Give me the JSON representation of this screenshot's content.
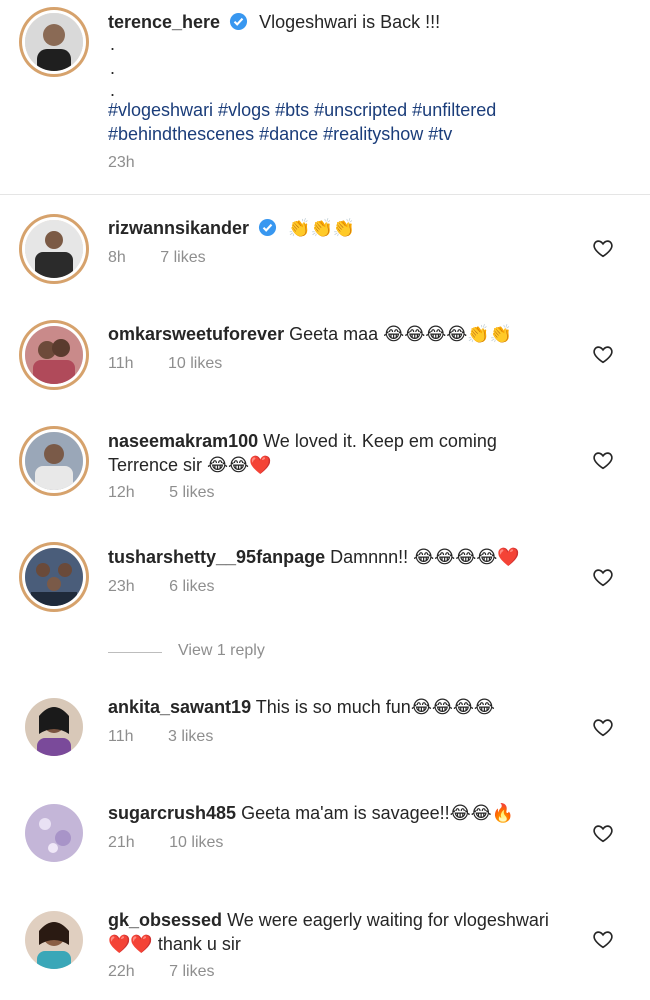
{
  "caption": {
    "username": "terence_here",
    "text": "Vlogeshwari is Back !!!",
    "dots": [
      ".",
      ".",
      "."
    ],
    "hashtags_line1": "#vlogeshwari #vlogs #bts #unscripted #unfiltered",
    "hashtags_line2": "#behindthescenes #dance #realityshow #tv",
    "time": "23h"
  },
  "comments": [
    {
      "username": "rizwannsikander",
      "text": "👏👏👏",
      "time": "8h",
      "likes": "7 likes"
    },
    {
      "username": "omkarsweetuforever",
      "text": "Geeta maa 😂😂😂😂👏👏",
      "time": "11h",
      "likes": "10 likes"
    },
    {
      "username": "naseemakram100",
      "text": "We loved it. Keep em coming",
      "text2": "Terrence sir 😂😂❤️",
      "time": "12h",
      "likes": "5 likes"
    },
    {
      "username": "tusharshetty__95fanpage",
      "text": "Damnnn!! 😂😂😂😂❤️",
      "time": "23h",
      "likes": "6 likes"
    },
    {
      "username": "ankita_sawant19",
      "text": "This is so much fun😂😂😂😂",
      "time": "11h",
      "likes": "3 likes"
    },
    {
      "username": "sugarcrush485",
      "text": "Geeta ma'am is savagee!!😂😂🔥",
      "time": "21h",
      "likes": "10 likes"
    },
    {
      "username": "gk_obsessed",
      "text": "We were  eagerly  waiting for vlogeshwari",
      "text2": "❤️❤️ thank u sir",
      "time": "22h",
      "likes": "7 likes"
    }
  ],
  "view_replies": "View 1 reply",
  "icons": {
    "like": "heart-outline-icon",
    "verified": "verified-badge-icon"
  },
  "colors": {
    "verified": "#3897f0",
    "hashtag": "#1b3d7a",
    "muted": "#8e8e8e"
  }
}
